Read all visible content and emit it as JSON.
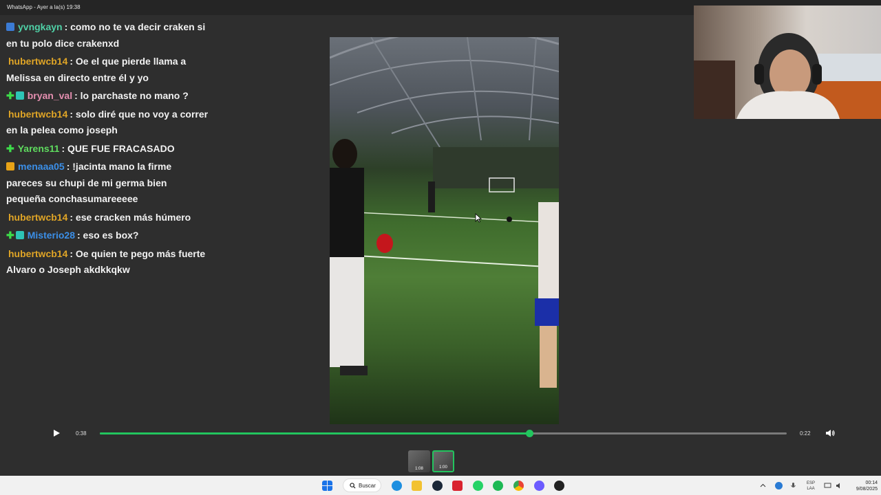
{
  "window": {
    "title": "WhatsApp - Ayer a la(s) 19:38"
  },
  "chat": {
    "messages": [
      {
        "user": "yvngkayn",
        "user_color": "#4fd0a6",
        "badges": [
          "sub"
        ],
        "lines": [
          ": como no te va decir craken si",
          "en tu polo dice crakenxd"
        ]
      },
      {
        "user": "hubertwcb14",
        "user_color": "#e0a526",
        "badges": [],
        "lines": [
          ": Oe el que pierde llama a",
          "Melissa en directo entre él y yo"
        ]
      },
      {
        "user": "bryan_val",
        "user_color": "#e58fb0",
        "badges": [
          "plus",
          "gift"
        ],
        "lines": [
          ": lo parchaste no mano ?"
        ]
      },
      {
        "user": "hubertwcb14",
        "user_color": "#e0a526",
        "badges": [],
        "lines": [
          ": solo diré que no voy a correr",
          "en la pelea como joseph"
        ]
      },
      {
        "user": "Yarens11",
        "user_color": "#5fdc5f",
        "badges": [
          "plus"
        ],
        "lines": [
          ": QUE FUE FRACASADO"
        ]
      },
      {
        "user": "menaaa05",
        "user_color": "#3b8fe8",
        "badges": [
          "gold"
        ],
        "lines": [
          ": !jacinta mano la firme",
          "pareces su chupi de mi germa bien",
          "pequeña conchasumareeeee"
        ]
      },
      {
        "user": "hubertwcb14",
        "user_color": "#e0a526",
        "badges": [],
        "lines": [
          ": ese cracken más húmero"
        ]
      },
      {
        "user": "Misterio28",
        "user_color": "#3b8fe8",
        "badges": [
          "plus",
          "gift"
        ],
        "lines": [
          ": eso es box?"
        ]
      },
      {
        "user": "hubertwcb14",
        "user_color": "#e0a526",
        "badges": [],
        "lines": [
          ": Oe quien te pego más fuerte",
          "Alvaro o Joseph akdkkqkw"
        ]
      }
    ]
  },
  "player": {
    "current_time": "0:38",
    "total_time": "0:22",
    "progress": 0.625,
    "accent": "#22c55e",
    "play_icon": "play-icon",
    "volume_icon": "volume-icon"
  },
  "thumbnails": [
    {
      "duration": "1:08",
      "active": false
    },
    {
      "duration": "1:00",
      "active": true
    }
  ],
  "taskbar": {
    "search_label": "Buscar",
    "lang_top": "ESP",
    "lang_bottom": "LAA",
    "time": "00:14",
    "date": "9/08/2025"
  }
}
